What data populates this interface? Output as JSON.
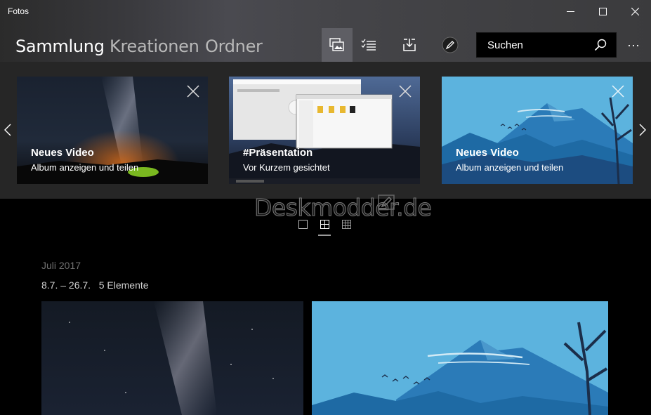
{
  "window": {
    "title": "Fotos"
  },
  "nav": {
    "tabs": [
      {
        "label": "Sammlung"
      },
      {
        "label": "Kreationen"
      },
      {
        "label": "Ordner"
      }
    ]
  },
  "toolbar": {
    "icons": [
      "slideshow-icon",
      "select-icon",
      "import-icon",
      "edit-pen-icon"
    ]
  },
  "search": {
    "placeholder": "Suchen"
  },
  "more": {
    "label": "···"
  },
  "carousel": {
    "cards": [
      {
        "title": "Neues Video",
        "subtitle": "Album anzeigen und teilen"
      },
      {
        "title": "#Präsentation",
        "subtitle": "Vor Kurzem gesichtet"
      },
      {
        "title": "Neues Video",
        "subtitle": "Album anzeigen und teilen"
      }
    ]
  },
  "watermark": {
    "text": "Deskmodder.de"
  },
  "timeline": {
    "month": "Juli 2017",
    "range": "8.7. – 26.7.",
    "count": "5 Elemente"
  },
  "colors": {
    "accent_sky": "#5bb1dc",
    "mountain": "#2a78b4",
    "dark_bg": "#000000"
  }
}
